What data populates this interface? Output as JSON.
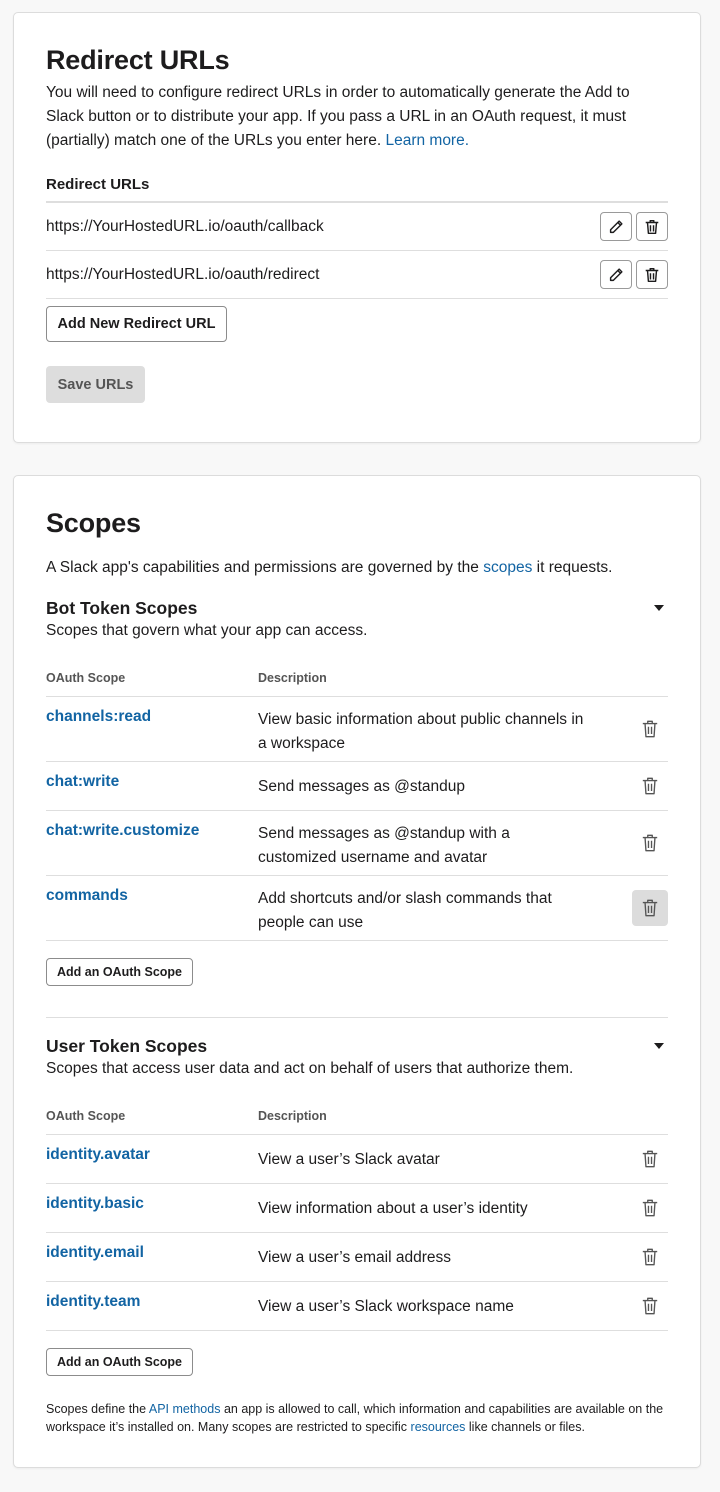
{
  "redirect": {
    "title": "Redirect URLs",
    "description": "You will need to configure redirect URLs in order to automatically generate the Add to Slack button or to distribute your app. If you pass a URL in an OAuth request, it must (partially) match one of the URLs you enter here.",
    "learn_more": "Learn more.",
    "list_label": "Redirect URLs",
    "urls": [
      "https://YourHostedURL.io/oauth/callback",
      "https://YourHostedURL.io/oauth/redirect"
    ],
    "add_button": "Add New Redirect URL",
    "save_button": "Save URLs"
  },
  "scopes": {
    "title": "Scopes",
    "intro_before": "A Slack app's capabilities and permissions are governed by the",
    "intro_link": "scopes",
    "intro_after": "it requests.",
    "bot": {
      "title": "Bot Token Scopes",
      "subtitle": "Scopes that govern what your app can access.",
      "col_scope": "OAuth Scope",
      "col_desc": "Description",
      "rows": [
        {
          "name": "channels:read",
          "desc": "View basic information about public channels in a workspace"
        },
        {
          "name": "chat:write",
          "desc": "Send messages as @standup"
        },
        {
          "name": "chat:write.customize",
          "desc": "Send messages as @standup with a customized username and avatar"
        },
        {
          "name": "commands",
          "desc": "Add shortcuts and/or slash commands that people can use"
        }
      ],
      "add_button": "Add an OAuth Scope"
    },
    "user": {
      "title": "User Token Scopes",
      "subtitle": "Scopes that access user data and act on behalf of users that authorize them.",
      "col_scope": "OAuth Scope",
      "col_desc": "Description",
      "rows": [
        {
          "name": "identity.avatar",
          "desc": "View a user’s Slack avatar"
        },
        {
          "name": "identity.basic",
          "desc": "View information about a user’s identity"
        },
        {
          "name": "identity.email",
          "desc": "View a user’s email address"
        },
        {
          "name": "identity.team",
          "desc": "View a user’s Slack workspace name"
        }
      ],
      "add_button": "Add an OAuth Scope"
    },
    "footer": {
      "before": "Scopes define the",
      "link1": "API methods",
      "middle": "an app is allowed to call, which information and capabilities are available on the workspace it’s installed on. Many scopes are restricted to specific",
      "link2": "resources",
      "after": "like channels or files."
    }
  },
  "colors": {
    "link": "#1264a3",
    "text": "#1d1c1d",
    "border": "#dedede"
  },
  "icons": {
    "edit": "pencil-icon",
    "delete": "trash-icon",
    "collapse": "caret-down-icon"
  }
}
